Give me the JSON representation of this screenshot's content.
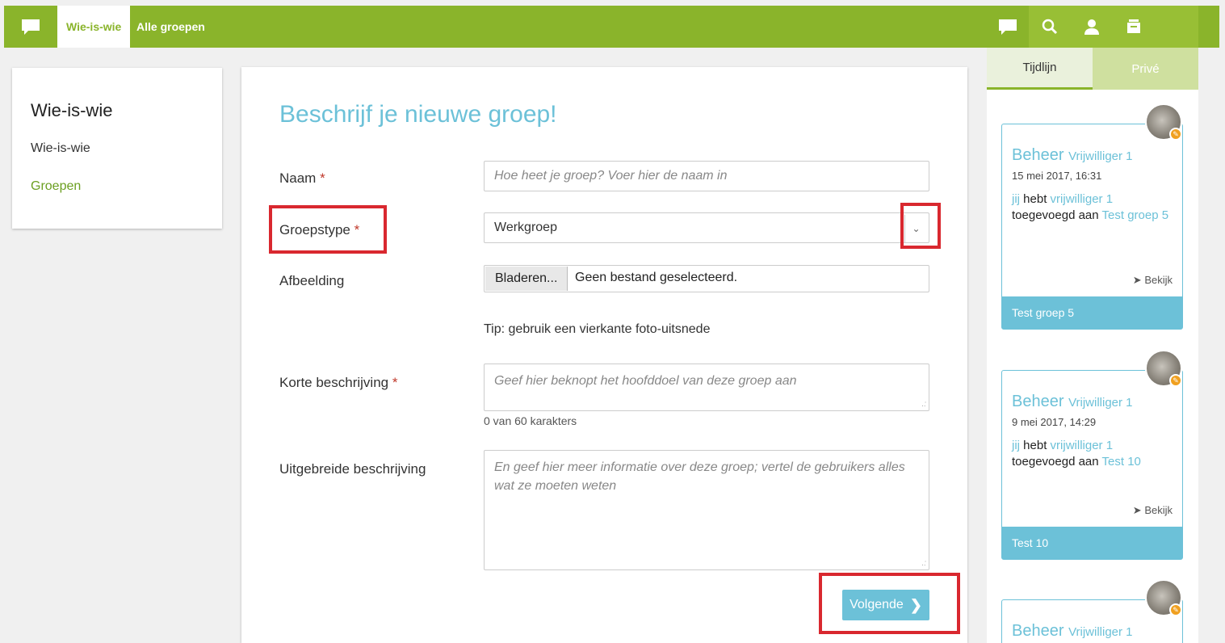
{
  "topbar": {
    "active_tab": "Wie-is-wie",
    "nav_item": "Alle groepen",
    "icons": [
      "chat-icon",
      "search-icon",
      "user-icon",
      "inbox-icon"
    ]
  },
  "sidebar": {
    "title": "Wie-is-wie",
    "items": [
      {
        "label": "Wie-is-wie"
      },
      {
        "label": "Groepen"
      }
    ]
  },
  "form": {
    "heading": "Beschrijf je nieuwe groep!",
    "required_mark": "*",
    "name_label": "Naam",
    "name_placeholder": "Hoe heet je groep? Voer hier de naam in",
    "type_label": "Groepstype",
    "type_value": "Werkgroep",
    "image_label": "Afbeelding",
    "browse_label": "Bladeren...",
    "file_status": "Geen bestand geselecteerd.",
    "tip": "Tip: gebruik een vierkante foto-uitsnede",
    "short_label": "Korte beschrijving",
    "short_placeholder": "Geef hier beknopt het hoofddoel van deze groep aan",
    "counter": "0 van 60 karakters",
    "long_label": "Uitgebreide beschrijving",
    "long_placeholder": "En geef hier meer informatie over deze groep; vertel de gebruikers alles wat ze moeten weten",
    "next_label": "Volgende"
  },
  "rightpanel": {
    "tabs": [
      {
        "label": "Tijdlijn"
      },
      {
        "label": "Privé"
      }
    ],
    "feed": [
      {
        "name": "Beheer",
        "sub": "Vrijwilliger 1",
        "time": "15 mei 2017, 16:31",
        "actor": "jij",
        "verb": "hebt",
        "object": "vrijwilliger 1",
        "phrase": "toegevoegd aan",
        "target": "Test groep 5",
        "bekijk": "Bekijk",
        "footer": "Test groep 5"
      },
      {
        "name": "Beheer",
        "sub": "Vrijwilliger 1",
        "time": "9 mei 2017, 14:29",
        "actor": "jij",
        "verb": "hebt",
        "object": "vrijwilliger 1",
        "phrase": "toegevoegd aan",
        "target": "Test 10",
        "bekijk": "Bekijk",
        "footer": "Test 10"
      },
      {
        "name": "Beheer",
        "sub": "Vrijwilliger 1"
      }
    ]
  },
  "colors": {
    "brand_green": "#8ab42b",
    "accent_blue": "#6cc1d8",
    "highlight_red": "#d9282f"
  }
}
